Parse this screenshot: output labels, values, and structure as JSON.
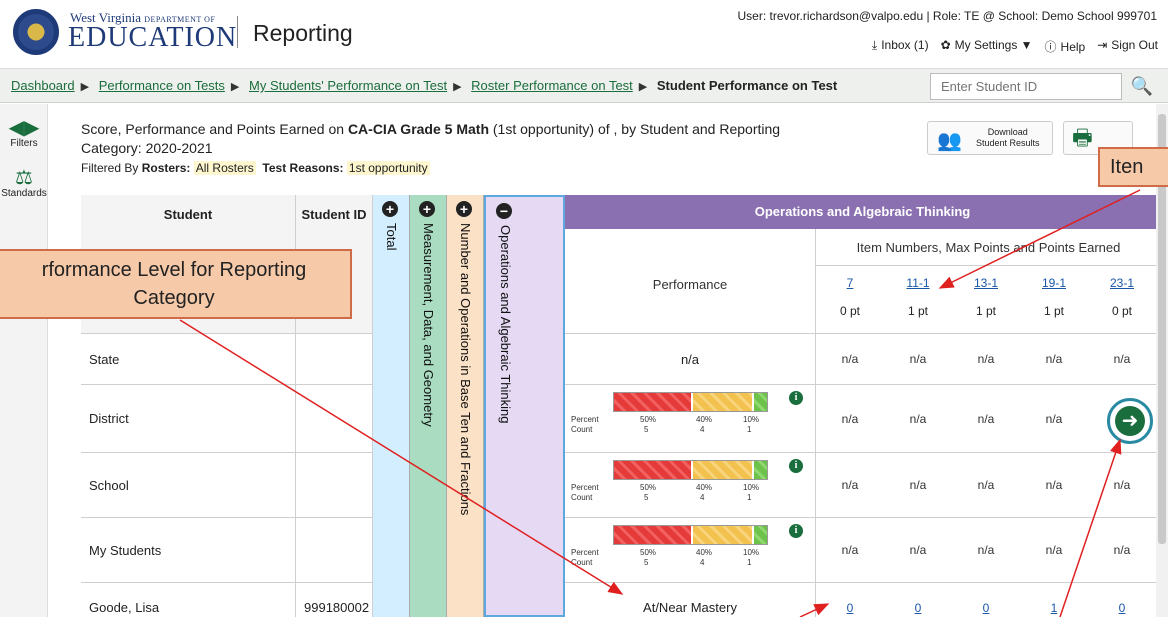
{
  "header": {
    "org_line_small": "West Virginia",
    "org_line_small_caps": "DEPARTMENT OF",
    "org_line_big": "EDUCATION",
    "app_title": "Reporting",
    "user_line": "User: trevor.richardson@valpo.edu  | Role: TE @ School: Demo School 999701",
    "tools": {
      "inbox": "Inbox (1)",
      "settings": "My Settings ▼",
      "help": "Help",
      "signout": "Sign Out"
    }
  },
  "breadcrumb": {
    "items": [
      "Dashboard",
      "Performance on Tests",
      "My Students' Performance on Test",
      "Roster Performance on Test"
    ],
    "current": "Student Performance on Test"
  },
  "search": {
    "placeholder": "Enter Student ID"
  },
  "rail": {
    "filters": "Filters",
    "standards": "Standards"
  },
  "report": {
    "title_prefix": "Score, Performance and Points Earned on ",
    "test_name": "CA-CIA Grade 5 Math",
    "title_suffix": " (1st opportunity) of , by Student and Reporting Category: 2020-2021",
    "filtered_by": "Filtered By",
    "rosters_label": "Rosters:",
    "rosters_value": "All Rosters",
    "reasons_label": "Test Reasons:",
    "reasons_value": "1st opportunity",
    "download_label_1": "Download",
    "download_label_2": "Student Results"
  },
  "table": {
    "col_student": "Student",
    "col_student_id": "Student ID",
    "vcols": [
      "Total",
      "Measurement, Data, and Geometry",
      "Number and Operations in Base Ten and Fractions",
      "Operations and Algebraic Thinking"
    ],
    "group_header": "Operations and Algebraic Thinking",
    "items_header": "Item Numbers, Max Points and Points Earned",
    "perf_header": "Performance",
    "items": [
      {
        "num": "7",
        "max": "0 pt"
      },
      {
        "num": "11-1",
        "max": "1 pt"
      },
      {
        "num": "13-1",
        "max": "1 pt"
      },
      {
        "num": "19-1",
        "max": "1 pt"
      },
      {
        "num": "23-1",
        "max": "0 pt"
      }
    ],
    "rows": [
      {
        "label": "State",
        "id": "",
        "perf": "n/a",
        "values": [
          "n/a",
          "n/a",
          "n/a",
          "n/a",
          "n/a"
        ]
      },
      {
        "label": "District",
        "id": "",
        "perf": "bar",
        "values": [
          "n/a",
          "n/a",
          "n/a",
          "n/a",
          ""
        ]
      },
      {
        "label": "School",
        "id": "",
        "perf": "bar",
        "values": [
          "n/a",
          "n/a",
          "n/a",
          "n/a",
          "n/a"
        ]
      },
      {
        "label": "My Students",
        "id": "",
        "perf": "bar",
        "values": [
          "n/a",
          "n/a",
          "n/a",
          "n/a",
          "n/a"
        ]
      },
      {
        "label": "Goode, Lisa",
        "id": "999180002",
        "perf": "At/Near Mastery",
        "values": [
          "0",
          "0",
          "0",
          "1",
          "0"
        ]
      }
    ],
    "bar": {
      "percent_label": "Percent",
      "count_label": "Count",
      "segments": [
        {
          "percent": "50%",
          "count": "5",
          "fraction": 0.5
        },
        {
          "percent": "40%",
          "count": "4",
          "fraction": 0.4
        },
        {
          "percent": "10%",
          "count": "1",
          "fraction": 0.1
        }
      ],
      "colors": {
        "red": "#e53a3a",
        "yellow": "#f2c14e",
        "green": "#6dc24b"
      }
    }
  },
  "annotations": {
    "callout_left_line1": "rformance Level for Reporting",
    "callout_left_line2": "Category",
    "callout_right": "Iten"
  }
}
